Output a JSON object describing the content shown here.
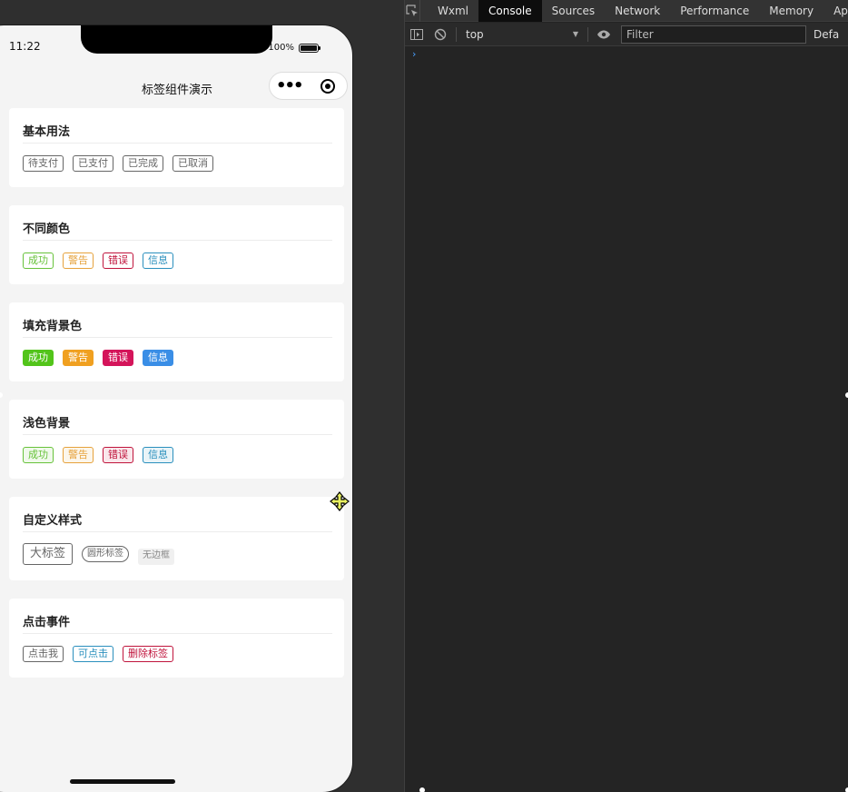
{
  "status": {
    "time": "11:22",
    "battery": "100%"
  },
  "navbar": {
    "title": "标签组件演示"
  },
  "sections": [
    {
      "title": "基本用法",
      "tags": [
        {
          "label": "待支付",
          "style": "outline",
          "color": "#666666"
        },
        {
          "label": "已支付",
          "style": "outline",
          "color": "#666666"
        },
        {
          "label": "已完成",
          "style": "outline",
          "color": "#666666"
        },
        {
          "label": "已取消",
          "style": "outline",
          "color": "#666666"
        }
      ]
    },
    {
      "title": "不同颜色",
      "tags": [
        {
          "label": "成功",
          "style": "outline",
          "color": "#67c23a"
        },
        {
          "label": "警告",
          "style": "outline",
          "color": "#e6a23c"
        },
        {
          "label": "错误",
          "style": "outline",
          "color": "#c0143c"
        },
        {
          "label": "信息",
          "style": "outline",
          "color": "#2a8fbd"
        }
      ]
    },
    {
      "title": "填充背景色",
      "tags": [
        {
          "label": "成功",
          "style": "fill",
          "color": "#52c41a"
        },
        {
          "label": "警告",
          "style": "fill",
          "color": "#f0a020"
        },
        {
          "label": "错误",
          "style": "fill",
          "color": "#d4145a"
        },
        {
          "label": "信息",
          "style": "fill",
          "color": "#3a8ee6"
        }
      ]
    },
    {
      "title": "浅色背景",
      "tags": [
        {
          "label": "成功",
          "style": "light",
          "color": "#67c23a"
        },
        {
          "label": "警告",
          "style": "light",
          "color": "#e6a23c"
        },
        {
          "label": "错误",
          "style": "light",
          "color": "#c0143c"
        },
        {
          "label": "信息",
          "style": "light",
          "color": "#2a8fbd"
        }
      ]
    },
    {
      "title": "自定义样式",
      "tags": [
        {
          "label": "大标签",
          "style": "large",
          "color": "#666666"
        },
        {
          "label": "圆形标签",
          "style": "round",
          "color": "#666666"
        },
        {
          "label": "无边框",
          "style": "borderless",
          "color": "#888888"
        }
      ]
    },
    {
      "title": "点击事件",
      "tags": [
        {
          "label": "点击我",
          "style": "outline",
          "color": "#666666"
        },
        {
          "label": "可点击",
          "style": "outline",
          "color": "#2a8fbd"
        },
        {
          "label": "删除标签",
          "style": "outline",
          "color": "#c0143c"
        }
      ]
    }
  ],
  "devtools": {
    "tabs": [
      "Wxml",
      "Console",
      "Sources",
      "Network",
      "Performance",
      "Memory",
      "Appl"
    ],
    "active_tab": "Console",
    "context": "top",
    "filter_placeholder": "Filter",
    "levels_label": "Defa",
    "prompt": "›"
  }
}
